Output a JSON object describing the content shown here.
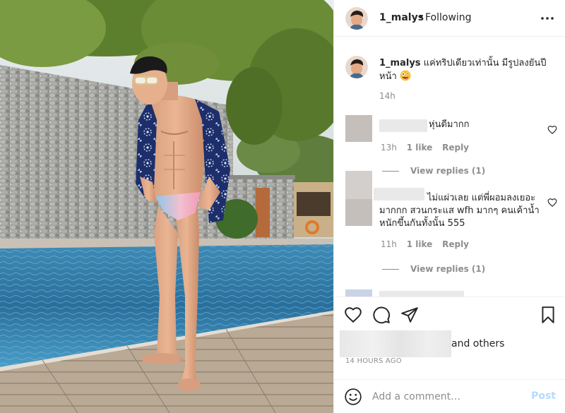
{
  "post": {
    "photo_alt": "pool-side-photo"
  },
  "header": {
    "username": "1_malys",
    "separator": "•",
    "follow_status": "Following"
  },
  "caption": {
    "username": "1_malys",
    "text": "แค่ทริปเดียวเท่านั้น มีรูปลงยันปีหน้า",
    "emoji": "zany-face-emoji",
    "time": "14h"
  },
  "comments": [
    {
      "text": "หุ่นดีมากก",
      "time": "13h",
      "likes": "1 like",
      "reply": "Reply",
      "view_replies": "View replies (1)"
    },
    {
      "text": "ไม่แผ่วเลย แต่พี่ผอมลงเยอะมากกก สวนกระแส wfh มากๆ คนเค้าน้ำหนักขึ้นกันทั้งนั้น 555",
      "time": "11h",
      "likes": "1 like",
      "reply": "Reply",
      "view_replies": "View replies (1)"
    }
  ],
  "likes": {
    "others_text": "and others"
  },
  "timestamp": "14 HOURS AGO",
  "add_comment": {
    "placeholder": "Add a comment…",
    "post_label": "Post"
  },
  "colors": {
    "link_disabled": "#b3dbff",
    "muted": "#8e8e8e",
    "text": "#262626",
    "divider": "#efefef"
  }
}
